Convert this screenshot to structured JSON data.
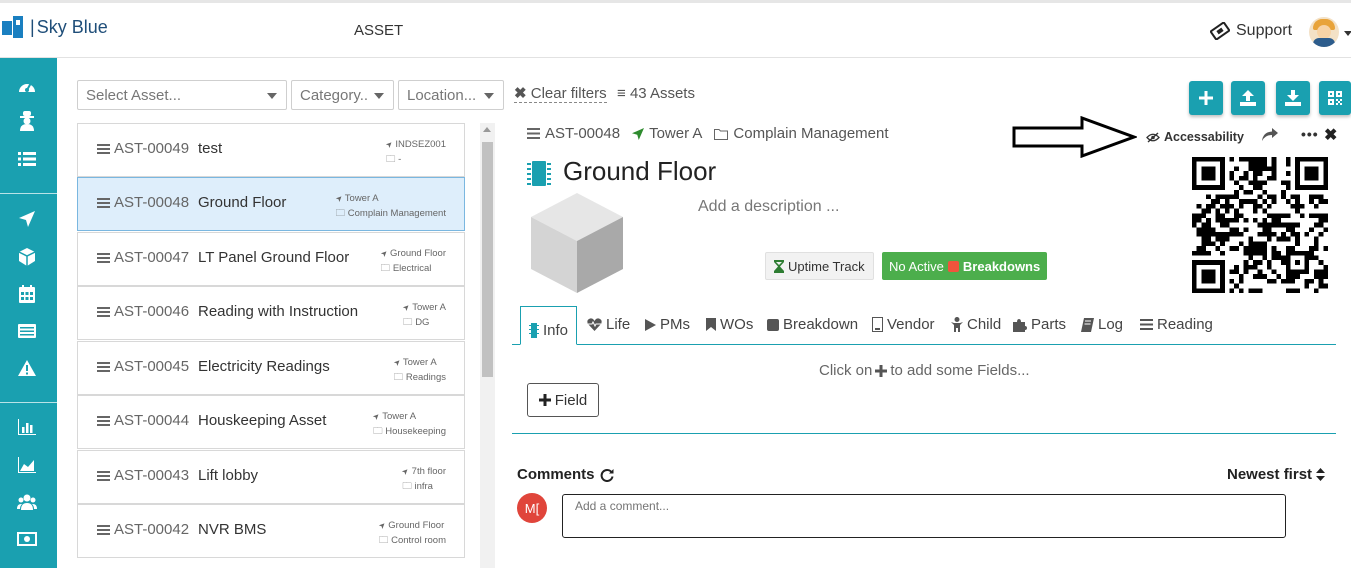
{
  "header": {
    "brand": "Sky Blue",
    "page_title": "ASSET",
    "support_label": "Support"
  },
  "sidebar": {
    "icons": [
      "dashboard-icon",
      "user-secret-icon",
      "list-icon",
      "location-arrow-icon",
      "cube-icon",
      "calendar-icon",
      "id-card-icon",
      "warning-icon",
      "bar-chart-icon",
      "area-chart-icon",
      "users-icon",
      "money-icon"
    ]
  },
  "filters": {
    "asset_placeholder": "Select Asset...",
    "category_placeholder": "Category..",
    "location_placeholder": "Location...",
    "clear_label": "Clear filters",
    "count_label": "43 Assets"
  },
  "toolbar": {
    "buttons": [
      "add-icon",
      "upload-icon",
      "download-icon",
      "qrcode-icon"
    ]
  },
  "assets": [
    {
      "code": "AST-00049",
      "name": "test",
      "location": "INDSEZ001",
      "category": "-"
    },
    {
      "code": "AST-00048",
      "name": "Ground Floor",
      "location": "Tower A",
      "category": "Complain Management"
    },
    {
      "code": "AST-00047",
      "name": "LT Panel Ground Floor",
      "location": "Ground Floor",
      "category": "Electrical"
    },
    {
      "code": "AST-00046",
      "name": "Reading with Instruction",
      "location": "Tower A",
      "category": "DG"
    },
    {
      "code": "AST-00045",
      "name": "Electricity Readings",
      "location": "Tower A",
      "category": "Readings"
    },
    {
      "code": "AST-00044",
      "name": "Houskeeping Asset",
      "location": "Tower A",
      "category": "Housekeeping"
    },
    {
      "code": "AST-00043",
      "name": "Lift lobby",
      "location": "7th floor",
      "category": "infra"
    },
    {
      "code": "AST-00042",
      "name": "NVR BMS",
      "location": "Ground Floor",
      "category": "Control room"
    }
  ],
  "detail": {
    "code": "AST-00048",
    "location": "Tower A",
    "category": "Complain Management",
    "accessibility_label": "Accessability",
    "title": "Ground Floor",
    "description_placeholder": "Add a description ...",
    "uptime_label": "Uptime Track",
    "no_active_label": "No Active",
    "breakdowns_label": "Breakdowns",
    "tabs": [
      "Info",
      "Life",
      "PMs",
      "WOs",
      "Breakdown",
      "Vendor",
      "Child",
      "Parts",
      "Log",
      "Reading"
    ],
    "fields_hint_prefix": "Click on",
    "fields_hint_suffix": "to add some Fields...",
    "field_button": "Field",
    "comments_label": "Comments",
    "sort_label": "Newest first",
    "comment_avatar": "M[",
    "comment_placeholder": "Add a comment..."
  }
}
